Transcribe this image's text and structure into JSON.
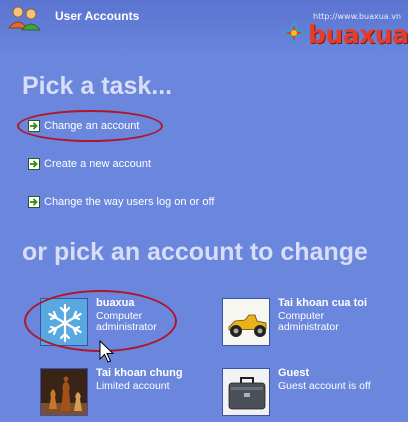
{
  "window": {
    "title": "User Accounts"
  },
  "watermark": {
    "url": "http://www.buaxua.vn",
    "brand": "buaxua"
  },
  "pick_task": {
    "heading": "Pick a task...",
    "tasks": [
      {
        "label": "Change an account"
      },
      {
        "label": "Create a new account"
      },
      {
        "label": "Change the way users log on or off"
      }
    ]
  },
  "pick_account": {
    "heading": "or pick an account to change",
    "accounts": [
      {
        "name": "buaxua",
        "line1": "Computer",
        "line2": "administrator",
        "picture": "snowflake"
      },
      {
        "name": "Tai khoan cua toi",
        "line1": "Computer",
        "line2": "administrator",
        "picture": "race-car"
      },
      {
        "name": "Tai khoan chung",
        "line1": "Limited account",
        "line2": "",
        "picture": "chess-pieces"
      },
      {
        "name": "Guest",
        "line1": "Guest account is off",
        "line2": "",
        "picture": "suitcase"
      }
    ]
  },
  "colors": {
    "background": "#6b86dd",
    "highlight_oval": "#b0162a",
    "heading_text": "#d7def7",
    "watermark_brand": "#e53d2b"
  }
}
